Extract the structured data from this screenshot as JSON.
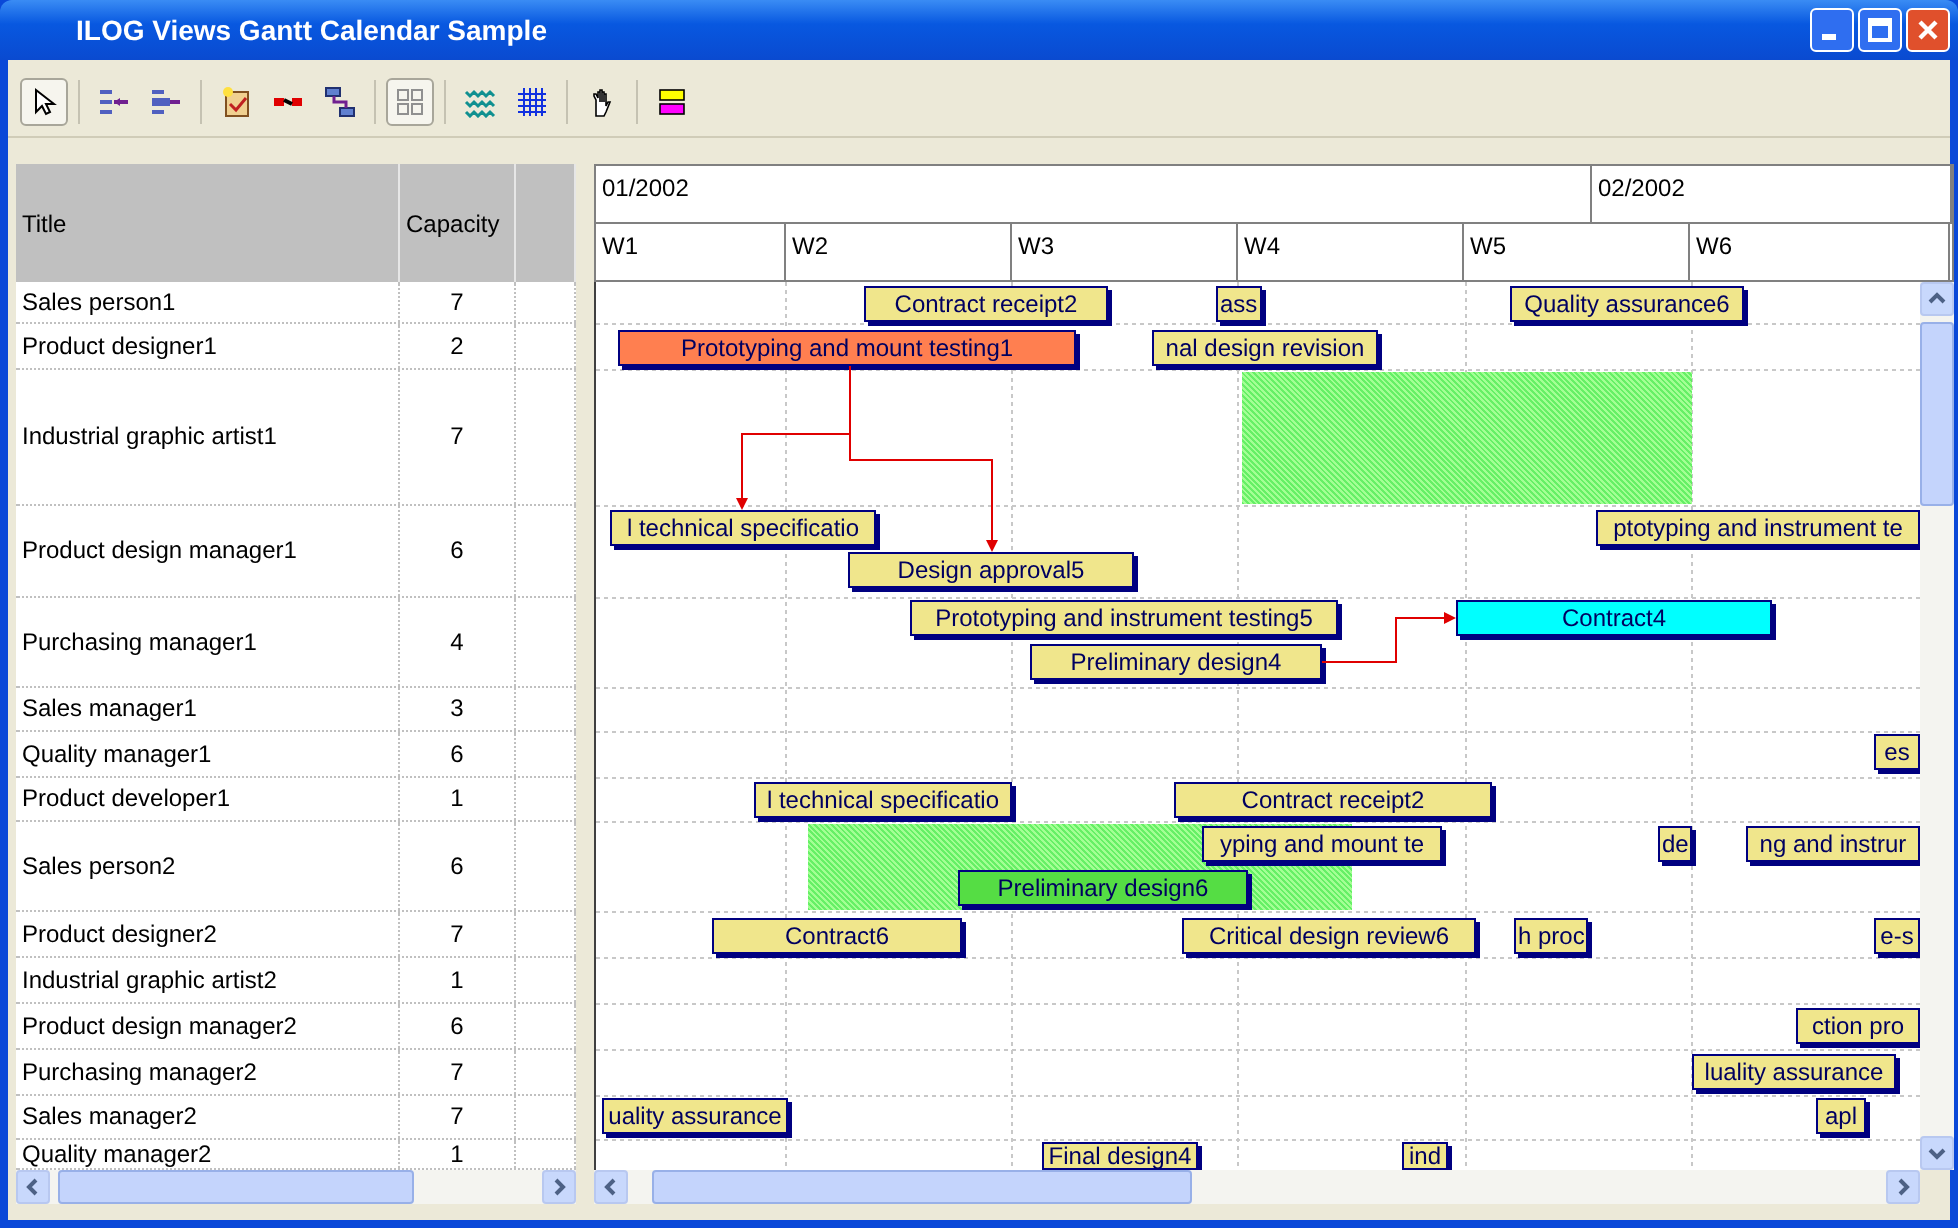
{
  "window": {
    "title": "ILOG Views Gantt Calendar Sample"
  },
  "toolbar": [
    {
      "selected": true
    },
    {
      "selected": false
    },
    {
      "selected": false
    },
    {
      "selected": false
    },
    {
      "selected": false
    },
    {
      "selected": false
    },
    {
      "selected": true
    },
    {
      "selected": false
    },
    {
      "selected": false
    },
    {
      "selected": false
    },
    {
      "selected": false
    }
  ],
  "table": {
    "columns": [
      "Title",
      "Capacity"
    ],
    "rows": [
      {
        "title": "Sales person1",
        "capacity": "7"
      },
      {
        "title": "Product designer1",
        "capacity": "2"
      },
      {
        "title": "Industrial graphic artist1",
        "capacity": "7"
      },
      {
        "title": "Product design manager1",
        "capacity": "6"
      },
      {
        "title": "Purchasing manager1",
        "capacity": "4"
      },
      {
        "title": "Sales manager1",
        "capacity": "3"
      },
      {
        "title": "Quality manager1",
        "capacity": "6"
      },
      {
        "title": "Product developer1",
        "capacity": "1"
      },
      {
        "title": "Sales person2",
        "capacity": "6"
      },
      {
        "title": "Product designer2",
        "capacity": "7"
      },
      {
        "title": "Industrial graphic artist2",
        "capacity": "1"
      },
      {
        "title": "Product design manager2",
        "capacity": "6"
      },
      {
        "title": "Purchasing manager2",
        "capacity": "7"
      },
      {
        "title": "Sales manager2",
        "capacity": "7"
      },
      {
        "title": "Quality manager2",
        "capacity": "1"
      }
    ]
  },
  "timescale": {
    "months": [
      "01/2002",
      "02/2002"
    ],
    "weeks": [
      "W1",
      "W2",
      "W3",
      "W4",
      "W5",
      "W6"
    ]
  },
  "chart": {
    "rows": [
      {
        "tasks": [
          {
            "label": "Contract receipt2",
            "color": "#f0e68c"
          },
          {
            "label": "ass",
            "color": "#f0e68c"
          },
          {
            "label": "Quality assurance6",
            "color": "#f0e68c"
          }
        ]
      },
      {
        "tasks": [
          {
            "label": "Prototyping and mount testing1",
            "color": "#ff7f50"
          },
          {
            "label": "nal design revision",
            "color": "#f0e68c"
          }
        ]
      },
      {
        "tasks": [
          {
            "kind": "reservation"
          }
        ]
      },
      {
        "tasks": [
          {
            "label": "l technical specificatio",
            "color": "#f0e68c"
          },
          {
            "label": "ptotyping and instrument te",
            "color": "#f0e68c"
          },
          {
            "label": "Design approval5",
            "color": "#f0e68c"
          }
        ]
      },
      {
        "tasks": [
          {
            "label": "Prototyping and instrument testing5",
            "color": "#f0e68c"
          },
          {
            "label": "Contract4",
            "color": "#00ffff"
          },
          {
            "label": "Preliminary design4",
            "color": "#f0e68c"
          }
        ]
      },
      {
        "tasks": []
      },
      {
        "tasks": [
          {
            "label": "es",
            "color": "#f0e68c"
          }
        ]
      },
      {
        "tasks": [
          {
            "label": "l technical specificatio",
            "color": "#f0e68c"
          },
          {
            "label": "Contract receipt2",
            "color": "#f0e68c"
          }
        ]
      },
      {
        "tasks": [
          {
            "kind": "reservation"
          },
          {
            "label": "yping and mount te",
            "color": "#f0e68c"
          },
          {
            "label": "de",
            "color": "#f0e68c"
          },
          {
            "label": "ng and instrur",
            "color": "#f0e68c"
          },
          {
            "label": "Preliminary design6",
            "color": "#55dd44"
          }
        ]
      },
      {
        "tasks": [
          {
            "label": "Contract6",
            "color": "#f0e68c"
          },
          {
            "label": "Critical design review6",
            "color": "#f0e68c"
          },
          {
            "label": "h proc",
            "color": "#f0e68c"
          },
          {
            "label": "e-s",
            "color": "#f0e68c"
          }
        ]
      },
      {
        "tasks": []
      },
      {
        "tasks": [
          {
            "label": "ction pro",
            "color": "#f0e68c"
          }
        ]
      },
      {
        "tasks": [
          {
            "label": "luality assurance",
            "color": "#f0e68c"
          }
        ]
      },
      {
        "tasks": [
          {
            "label": "uality assurance",
            "color": "#f0e68c"
          },
          {
            "label": "apl",
            "color": "#f0e68c"
          }
        ]
      },
      {
        "tasks": [
          {
            "label": "Final design4",
            "color": "#f0e68c"
          },
          {
            "label": "ind",
            "color": "#f0e68c"
          }
        ]
      }
    ]
  }
}
